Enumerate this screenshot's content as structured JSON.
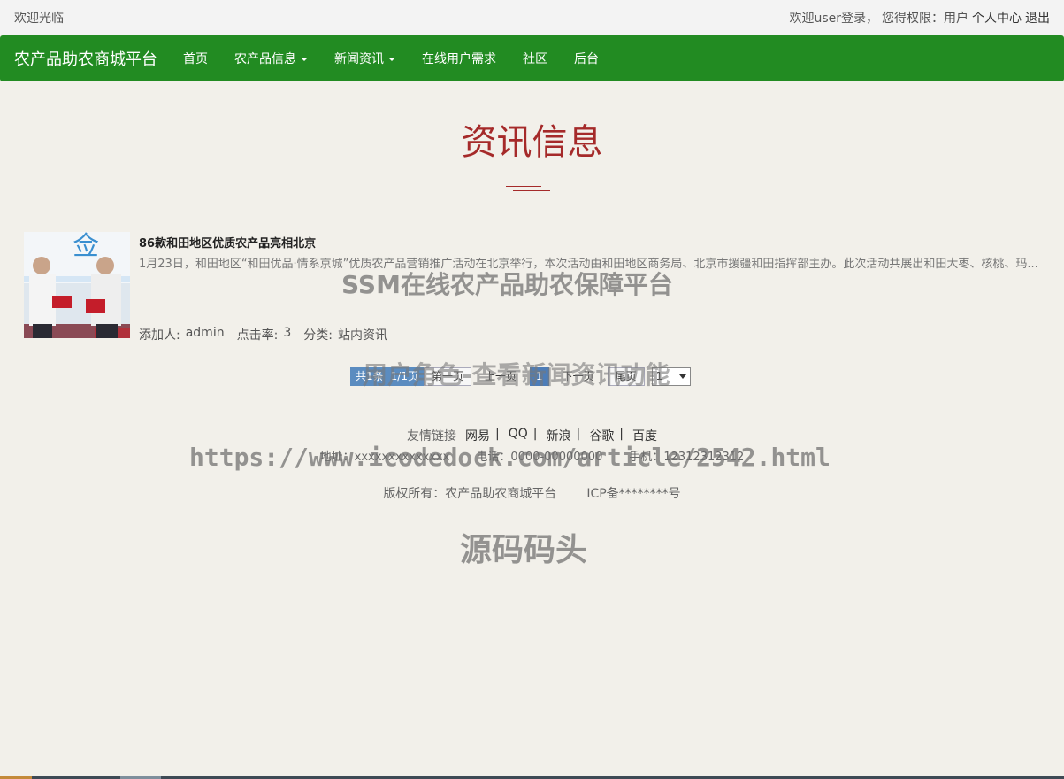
{
  "topbar": {
    "welcome": "欢迎光临",
    "login_text": "欢迎user登录，",
    "role_text": "您得权限：用户",
    "personal_center": "个人中心",
    "logout": "退出"
  },
  "navbar": {
    "brand": "农产品助农商城平台",
    "items": [
      {
        "label": "首页",
        "dropdown": false
      },
      {
        "label": "农产品信息",
        "dropdown": true
      },
      {
        "label": "新闻资讯",
        "dropdown": true
      },
      {
        "label": "在线用户需求",
        "dropdown": false
      },
      {
        "label": "社区",
        "dropdown": false
      },
      {
        "label": "后台",
        "dropdown": false
      }
    ]
  },
  "page": {
    "title": "资讯信息"
  },
  "article": {
    "title": "86款和田地区优质农产品亮相北京",
    "summary": "1月23日，和田地区“和田优品·情系京城”优质农产品营销推广活动在北京举行，本次活动由和田地区商务局、北京市援疆和田指挥部主办。此次活动共展出和田大枣、核桃、玛...",
    "added_by_label": "添加人:",
    "added_by": "admin",
    "clicks_label": "点击率:",
    "clicks": "3",
    "category_label": "分类:",
    "category": "站内资讯",
    "thumb_text": "佥"
  },
  "pager": {
    "total": "共1条",
    "pages": "1/1页",
    "first": "第一页",
    "prev": "上一页",
    "current": "1",
    "next": "下一页",
    "last": "尾页",
    "select_value": "1"
  },
  "footer": {
    "links_label": "友情链接",
    "links": [
      "网易",
      "QQ",
      "新浪",
      "谷歌",
      "百度"
    ],
    "address": "地址：xxxxxxxxxxxxxx",
    "phone": "电话：0000-00000000",
    "mobile": "手机：12312312312",
    "copyright": "版权所有：农产品助农商城平台",
    "icp": "ICP备********号"
  },
  "watermarks": {
    "line1": "SSM在线农产品助农保障平台",
    "line2": "用户角色-查看新闻资讯功能",
    "line3": "https://www.icodedock.com/article/2542.html",
    "line4": "源码码头"
  },
  "colors": {
    "nav_bg": "#228b22",
    "title": "#a52a2a",
    "background": "#f2f0ea"
  }
}
